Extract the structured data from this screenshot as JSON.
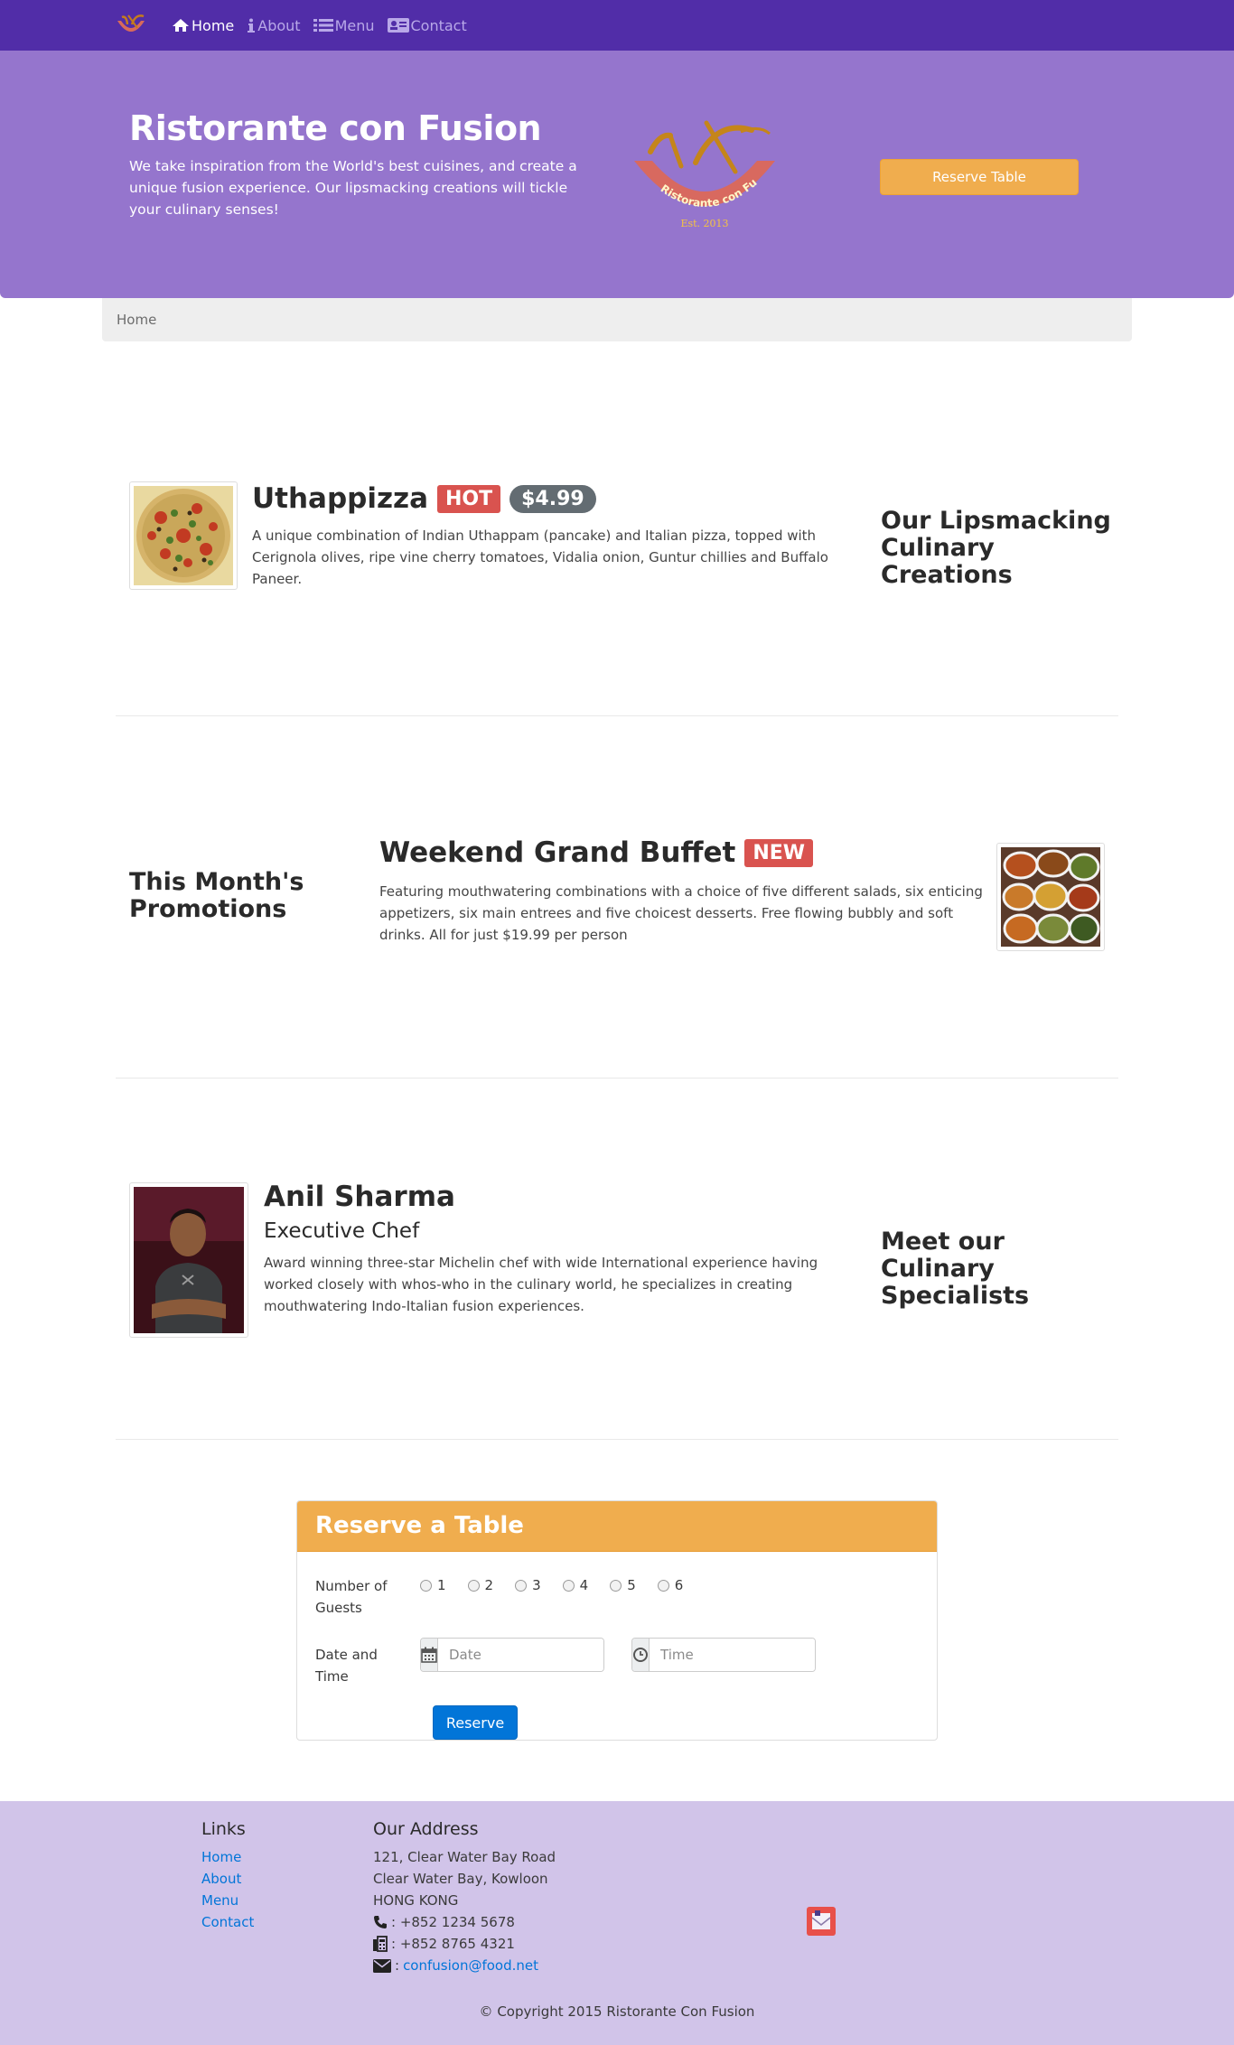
{
  "nav": {
    "items": [
      {
        "label": "Home",
        "icon": "home-icon"
      },
      {
        "label": "About",
        "icon": "info-icon"
      },
      {
        "label": "Menu",
        "icon": "list-icon"
      },
      {
        "label": "Contact",
        "icon": "address-card-icon"
      }
    ]
  },
  "jumbotron": {
    "title": "Ristorante con Fusion",
    "text": "We take inspiration from the World's best cuisines, and create a unique fusion experience. Our lipsmacking creations will tickle your culinary senses!",
    "logo_text": "Ristorante con Fusion",
    "logo_est": "Est. 2013",
    "reserve_label": "Reserve Table"
  },
  "breadcrumb": {
    "current": "Home"
  },
  "dish": {
    "name": "Uthappizza",
    "badge": "HOT",
    "price": "$4.99",
    "description": "A unique combination of Indian Uthappam (pancake) and Italian pizza, topped with Cerignola olives, ripe vine cherry tomatoes, Vidalia onion, Guntur chillies and Buffalo Paneer.",
    "section_heading": "Our Lipsmacking Culinary Creations"
  },
  "promotion": {
    "section_heading": "This Month's Promotions",
    "name": "Weekend Grand Buffet",
    "badge": "NEW",
    "description": "Featuring mouthwatering combinations with a choice of five different salads, six enticing appetizers, six main entrees and five choicest desserts. Free flowing bubbly and soft drinks. All for just $19.99 per person"
  },
  "leader": {
    "name": "Anil Sharma",
    "designation": "Executive Chef",
    "description": "Award winning three-star Michelin chef with wide International experience having worked closely with whos-who in the culinary world, he specializes in creating mouthwatering Indo-Italian fusion experiences.",
    "section_heading": "Meet our Culinary Specialists"
  },
  "reservation": {
    "title": "Reserve a Table",
    "guests_label": "Number of Guests",
    "guest_options": [
      "1",
      "2",
      "3",
      "4",
      "5",
      "6"
    ],
    "datetime_label": "Date and Time",
    "date_placeholder": "Date",
    "time_placeholder": "Time",
    "submit_label": "Reserve"
  },
  "footer": {
    "links_heading": "Links",
    "links": [
      "Home",
      "About",
      "Menu",
      "Contact"
    ],
    "address_heading": "Our Address",
    "address_lines": [
      "121, Clear Water Bay Road",
      "Clear Water Bay, Kowloon",
      "HONG KONG"
    ],
    "phone": ": +852 1234 5678",
    "fax": ": +852 8765 4321",
    "email_prefix": ":",
    "email": "confusion@food.net",
    "copyright": "© Copyright 2015 Ristorante Con Fusion"
  },
  "colors": {
    "navbar": "#512da8",
    "jumbotron": "#9575cd",
    "footer": "#d1c4e9",
    "warning": "#f0ad4e",
    "primary": "#0275d8",
    "danger": "#d9534f"
  }
}
